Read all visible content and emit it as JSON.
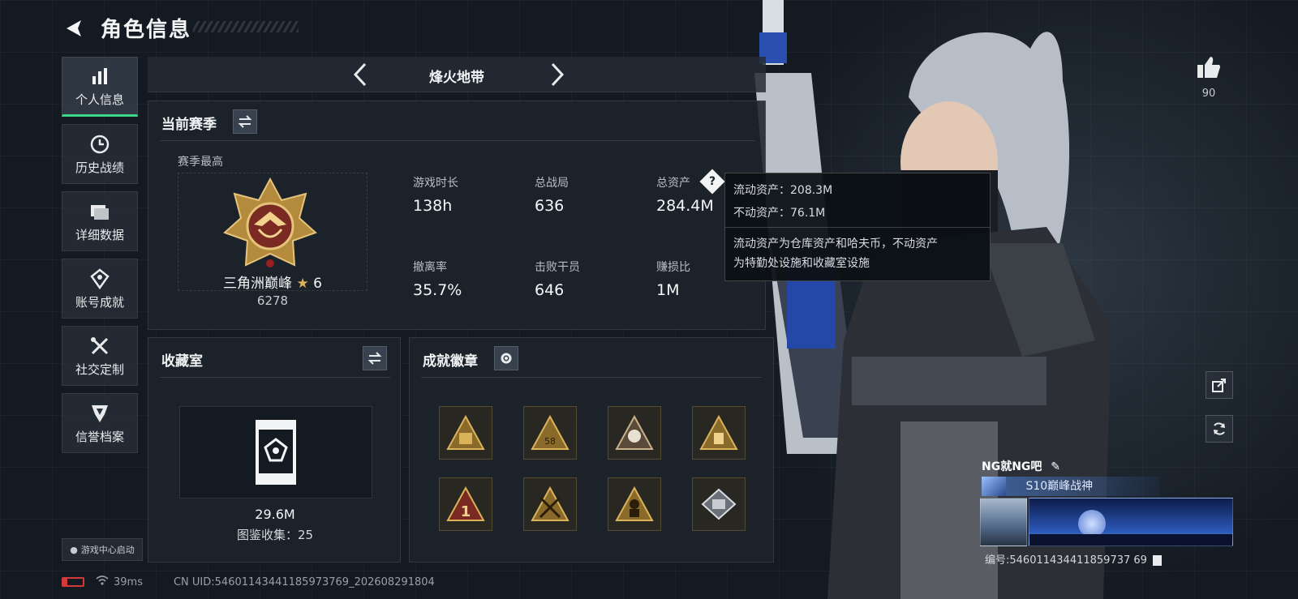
{
  "header": {
    "title": "角色信息"
  },
  "nav": {
    "items": [
      {
        "label": "个人信息",
        "icon": "bar-chart-icon",
        "active": true
      },
      {
        "label": "历史战绩",
        "icon": "clock-icon",
        "active": false
      },
      {
        "label": "详细数据",
        "icon": "folder-icon",
        "active": false
      },
      {
        "label": "账号成就",
        "icon": "medal-icon",
        "active": false
      },
      {
        "label": "社交定制",
        "icon": "tools-icon",
        "active": false
      },
      {
        "label": "信誉档案",
        "icon": "shield-icon",
        "active": false
      }
    ],
    "footer_label": "游戏中心启动"
  },
  "mode": {
    "title": "烽火地带"
  },
  "season": {
    "title": "当前赛季",
    "best_label": "赛季最高",
    "rank_name": "三角洲巅峰",
    "rank_stars": "6",
    "rank_score": "6278",
    "stats": [
      {
        "label": "游戏时长",
        "value": "138h"
      },
      {
        "label": "总战局",
        "value": "636"
      },
      {
        "label": "总资产",
        "value": "284.4M"
      },
      {
        "label": "撤离率",
        "value": "35.7%"
      },
      {
        "label": "击败干员",
        "value": "646"
      },
      {
        "label": "赚损比",
        "value": "1M"
      }
    ]
  },
  "tooltip": {
    "line1": "流动资产：208.3M",
    "line2": "不动资产：76.1M",
    "desc1": "流动资产为仓库资产和哈夫币，不动资产",
    "desc2": "为特勤处设施和收藏室设施"
  },
  "collection": {
    "title": "收藏室",
    "value": "29.6M",
    "count_line": "图鉴收集：25"
  },
  "achievements": {
    "title": "成就徽章",
    "badges": [
      "badge-icon",
      "badge-58-icon",
      "badge-skull-icon",
      "badge-gold-icon",
      "badge-1-icon",
      "badge-crossed-icon",
      "badge-soldier-icon",
      "badge-silver-icon"
    ]
  },
  "side": {
    "like_count": "90"
  },
  "player": {
    "name": "NG就NG吧",
    "title": "S10巅峰战神",
    "id_line": "编号:546011434411859737 69"
  },
  "status": {
    "ping": "39ms",
    "uid": "CN UID:54601143441185973769_202608291804"
  },
  "colors": {
    "accent": "#3cd68a",
    "gold": "#c9a052",
    "panel": "#1c232a"
  }
}
